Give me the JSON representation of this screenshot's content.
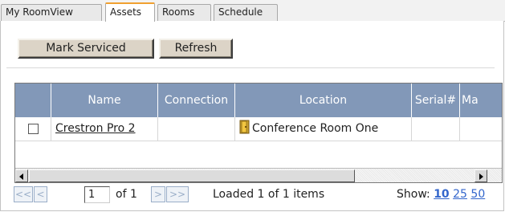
{
  "tabs": [
    {
      "label": "My RoomView",
      "active": false
    },
    {
      "label": "Assets",
      "active": true
    },
    {
      "label": "Rooms",
      "active": false
    },
    {
      "label": "Schedule",
      "active": false
    }
  ],
  "toolbar": {
    "mark_serviced_label": "Mark Serviced",
    "refresh_label": "Refresh"
  },
  "grid": {
    "columns": [
      "",
      "Name",
      "Connection",
      "Location",
      "Serial#",
      "Ma"
    ],
    "rows": [
      {
        "checked": false,
        "name": "Crestron Pro 2",
        "connection": "",
        "location": "Conference Room One",
        "location_icon": "door-icon",
        "serial": "",
        "ma": ""
      }
    ]
  },
  "pager": {
    "first_label": "<<",
    "prev_label": "<",
    "page_value": "1",
    "of_label": "of 1",
    "next_label": ">",
    "last_label": ">>",
    "status": "Loaded 1 of 1 items",
    "show_label": "Show:",
    "page_sizes": [
      "10",
      "25",
      "50"
    ],
    "selected_size": "10"
  },
  "colors": {
    "header_bg": "#8298b8",
    "active_tab_accent": "#f0a030",
    "link": "#3366cc"
  }
}
